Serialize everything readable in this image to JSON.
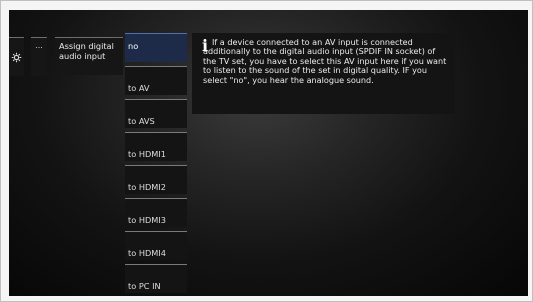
{
  "menu": {
    "more_label": "...",
    "assign_label_line1": "Assign digital",
    "assign_label_line2": "audio input"
  },
  "options": [
    {
      "label": "no",
      "selected": true
    },
    {
      "label": "to AV",
      "selected": false
    },
    {
      "label": "to AVS",
      "selected": false
    },
    {
      "label": "to HDMI1",
      "selected": false
    },
    {
      "label": "to HDMI2",
      "selected": false
    },
    {
      "label": "to HDMI3",
      "selected": false
    },
    {
      "label": "to HDMI4",
      "selected": false
    },
    {
      "label": "to PC IN",
      "selected": false
    }
  ],
  "info": {
    "icon": "info-icon",
    "text": "If a device connected to an AV input is connected additionally to the digital audio input (SPDIF IN socket) of the TV set, you have to select this AV input here if you want to listen to the sound of the set in digital quality. IF you select \"no\", you hear the analogue sound."
  },
  "colors": {
    "selected_background": "#1d2a48",
    "selected_border": "#5070b0",
    "tile_background": "#141414"
  }
}
